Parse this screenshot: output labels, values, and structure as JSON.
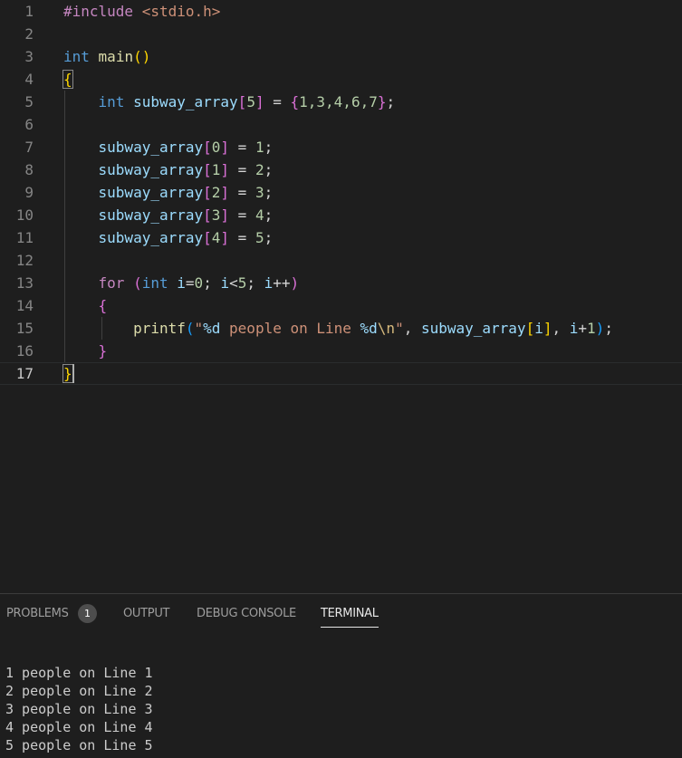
{
  "editor": {
    "line_numbers": [
      "1",
      "2",
      "3",
      "4",
      "5",
      "6",
      "7",
      "8",
      "9",
      "10",
      "11",
      "12",
      "13",
      "14",
      "15",
      "16",
      "17"
    ],
    "active_line": "17",
    "line1": {
      "include": "#include",
      "header": "<stdio.h>"
    },
    "line3": {
      "kw": "int",
      "fn": "main",
      "paren": "()"
    },
    "line4": {
      "brace": "{"
    },
    "line5": {
      "kw": "int",
      "var": "subway_array",
      "lb": "[",
      "size": "5",
      "rb": "]",
      "eq": " = ",
      "lbrace": "{",
      "values": "1,3,4,6,7",
      "rbrace": "}",
      "semi": ";"
    },
    "assignments": [
      {
        "var": "subway_array",
        "index": "0",
        "value": "1"
      },
      {
        "var": "subway_array",
        "index": "1",
        "value": "2"
      },
      {
        "var": "subway_array",
        "index": "2",
        "value": "3"
      },
      {
        "var": "subway_array",
        "index": "3",
        "value": "4"
      },
      {
        "var": "subway_array",
        "index": "4",
        "value": "5"
      }
    ],
    "line13": {
      "for": "for",
      "kw": "int",
      "var_i": "i",
      "init": "=",
      "zero": "0",
      "sep1": "; ",
      "cond_i": "i",
      "lt": "<",
      "five": "5",
      "sep2": "; ",
      "inc_i": "i",
      "inc": "++"
    },
    "line14": {
      "brace": "{"
    },
    "line15": {
      "fn": "printf",
      "str1": "\"",
      "fmt1": "%d",
      "str2": " people on Line ",
      "fmt2": "%d",
      "esc": "\\n",
      "str3": "\"",
      "comma": ", ",
      "var": "subway_array",
      "idx": "i",
      "comma2": ", ",
      "i": "i",
      "plus": "+",
      "one": "1",
      "semi": ";"
    },
    "line16": {
      "brace": "}"
    },
    "line17": {
      "brace": "}"
    }
  },
  "panel": {
    "tabs": {
      "problems": "PROBLEMS",
      "problems_count": "1",
      "output": "OUTPUT",
      "debug_console": "DEBUG CONSOLE",
      "terminal": "TERMINAL"
    },
    "active_tab": "TERMINAL",
    "terminal_lines": [
      "1 people on Line 1",
      "2 people on Line 2",
      "3 people on Line 3",
      "4 people on Line 4",
      "5 people on Line 5"
    ]
  },
  "colors": {
    "background": "#1e1e1e",
    "keyword": "#569cd6",
    "function": "#dcdcaa",
    "variable": "#9cdcfe",
    "number": "#b5cea8",
    "string": "#ce9178",
    "macro": "#c586c0",
    "bracket_level1": "#ffd700",
    "bracket_level2": "#da70d6",
    "bracket_level3": "#179fff"
  }
}
